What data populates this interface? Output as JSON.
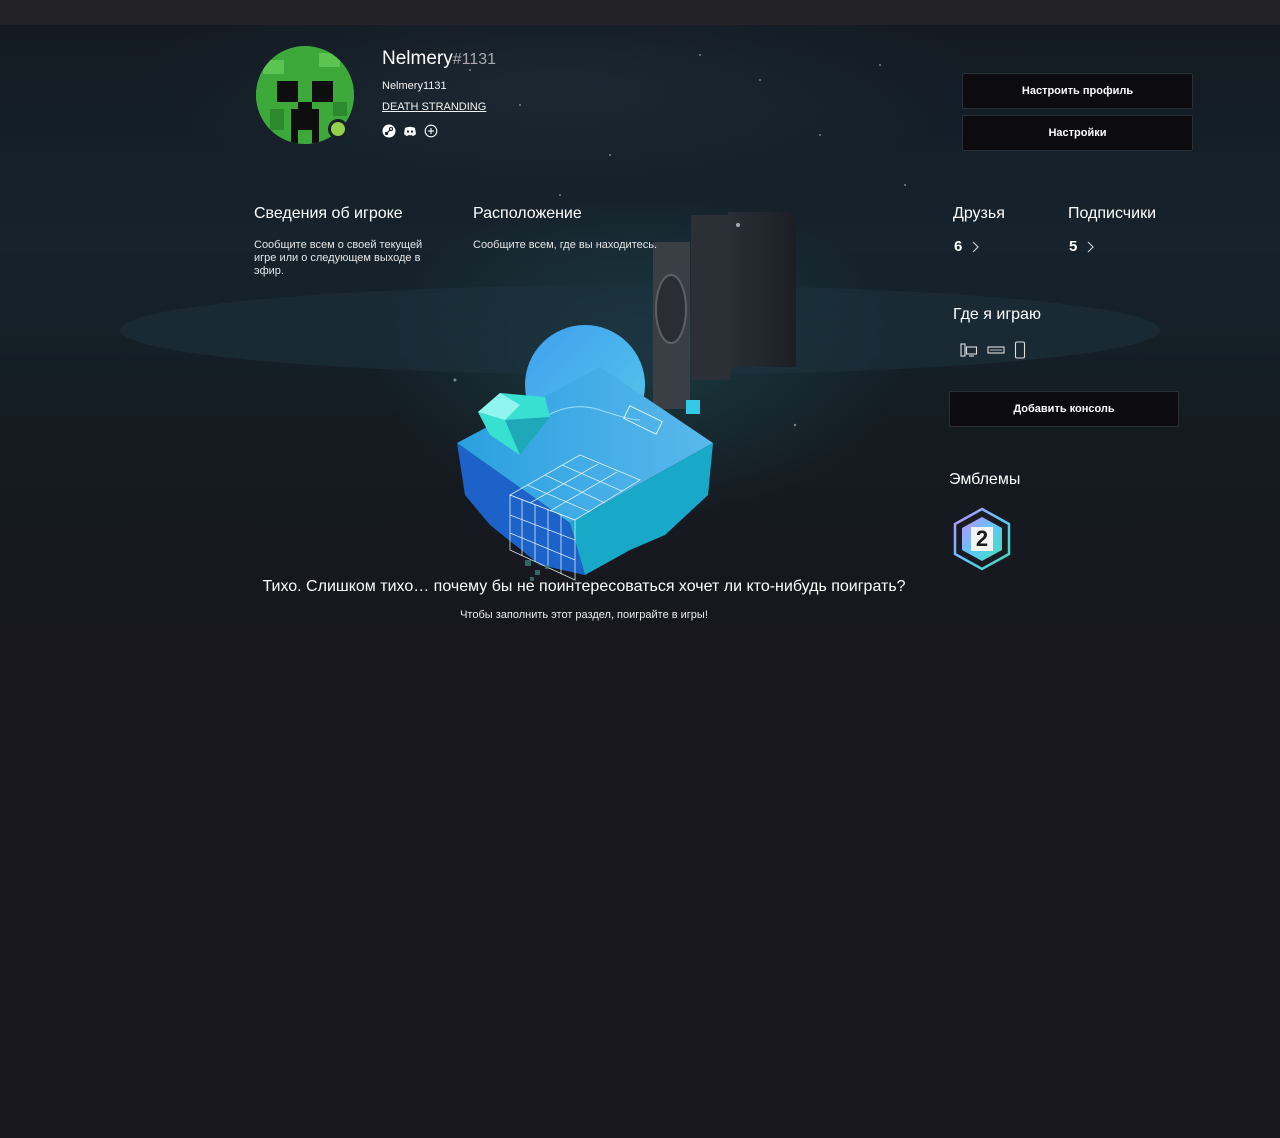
{
  "profile": {
    "gamertag": "Nelmery",
    "suffix": "#1131",
    "real_name": "Nelmery1131",
    "current_game": "DEATH STRANDING",
    "linked_accounts": [
      "steam-icon",
      "discord-icon",
      "add-circle-icon"
    ],
    "presence_color": "#92d04d"
  },
  "actions": {
    "customize_profile": "Настроить профиль",
    "settings": "Настройки"
  },
  "player_info": {
    "title": "Сведения об игроке",
    "description": "Сообщите всем о своей текущей игре или о следующем выходе в эфир."
  },
  "location": {
    "title": "Расположение",
    "description": "Сообщите всем, где вы находитесь."
  },
  "friends": {
    "title": "Друзья",
    "count": "6"
  },
  "followers": {
    "title": "Подписчики",
    "count": "5"
  },
  "where_i_play": {
    "title": "Где я играю",
    "devices": [
      "pc-icon",
      "console-icon",
      "mobile-icon"
    ],
    "add_console": "Добавить консоль"
  },
  "badges": {
    "title": "Эмблемы",
    "items": [
      {
        "icon": "level-badge-icon",
        "value": "2"
      }
    ]
  },
  "empty_state": {
    "title": "Тихо. Слишком тихо… почему бы не поинтересоваться хочет ли кто-нибудь поиграть?",
    "subtitle": "Чтобы заполнить этот раздел, поиграйте в игры!"
  }
}
